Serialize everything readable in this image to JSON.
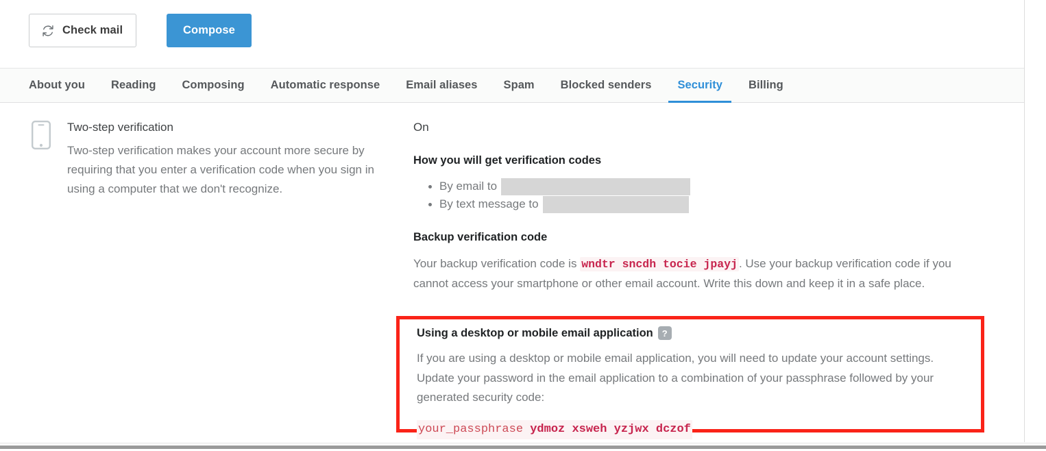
{
  "toolbar": {
    "check_mail_label": "Check mail",
    "check_mail_icon": "refresh-icon",
    "compose_label": "Compose",
    "compose_color": "#3b95d4"
  },
  "tabs": [
    {
      "label": "About you",
      "active": false
    },
    {
      "label": "Reading",
      "active": false
    },
    {
      "label": "Composing",
      "active": false
    },
    {
      "label": "Automatic response",
      "active": false
    },
    {
      "label": "Email aliases",
      "active": false
    },
    {
      "label": "Spam",
      "active": false
    },
    {
      "label": "Blocked senders",
      "active": false
    },
    {
      "label": "Security",
      "active": true
    },
    {
      "label": "Billing",
      "active": false
    }
  ],
  "active_tab_color": "#2f8fd8",
  "two_step": {
    "icon": "smartphone-icon",
    "title": "Two-step verification",
    "description": "Two-step verification makes your account more secure by requiring that you enter a verification code when you sign in using a computer that we don't recognize.",
    "status": "On"
  },
  "verification_codes": {
    "heading": "How you will get verification codes",
    "items": [
      {
        "label": "By email to",
        "value": "",
        "redacted": true
      },
      {
        "label": "By text message to",
        "value": "",
        "redacted": true
      }
    ]
  },
  "backup_code": {
    "heading": "Backup verification code",
    "text_before": "Your backup verification code is ",
    "code": "wndtr sncdh tocie jpayj",
    "text_after": ". Use your backup verification code if you cannot access your smartphone or other email account. Write this down and keep it in a safe place."
  },
  "email_application": {
    "heading": "Using a desktop or mobile email application",
    "help_icon": "question-mark-icon",
    "help_icon_glyph": "?",
    "paragraph": "If you are using a desktop or mobile email application, you will need to update your account settings. Update your password in the email application to a combination of your passphrase followed by your generated security code:",
    "passphrase_placeholder": "your_passphrase",
    "generated_code": "ydmoz xsweh yzjwx dczof",
    "highlight_border_color": "#fa2318",
    "code_color": "#c7254e"
  }
}
